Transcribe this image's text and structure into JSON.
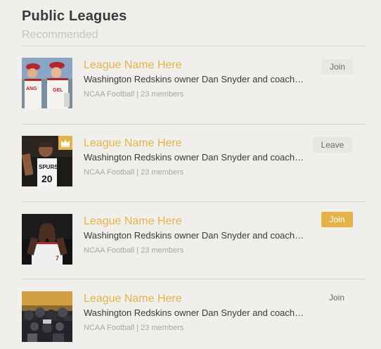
{
  "header": {
    "title": "Public Leagues",
    "subtitle": "Recommended"
  },
  "leagues": [
    {
      "name": "League Name Here",
      "description": "Washington Redskins owner Dan Snyder and coach…",
      "sport": "NCAA Football",
      "separator": "|",
      "members": "23 members",
      "action": "Join",
      "photo": "two-baseball-players-photo"
    },
    {
      "name": "League Name Here",
      "description": "Washington Redskins owner Dan Snyder and coach…",
      "sport": "NCAA Football",
      "separator": "|",
      "members": "23 members",
      "action": "Leave",
      "photo": "basketball-player-photo",
      "badge": "crown-icon"
    },
    {
      "name": "League Name Here",
      "description": "Washington Redskins owner Dan Snyder and coach…",
      "sport": "NCAA Football",
      "separator": "|",
      "members": "23 members",
      "action": "Join",
      "photo": "dejected-player-photo"
    },
    {
      "name": "League Name Here",
      "description": "Washington Redskins owner Dan Snyder and coach…",
      "sport": "NCAA Football",
      "separator": "|",
      "members": "23 members",
      "action": "Join",
      "photo": "crowd-photo"
    }
  ],
  "colors": {
    "accent": "#e3b448",
    "background": "#f1efeb",
    "text": "#3a3a3a",
    "muted": "#a9a6a1",
    "button_light": "#e9e7e2"
  }
}
